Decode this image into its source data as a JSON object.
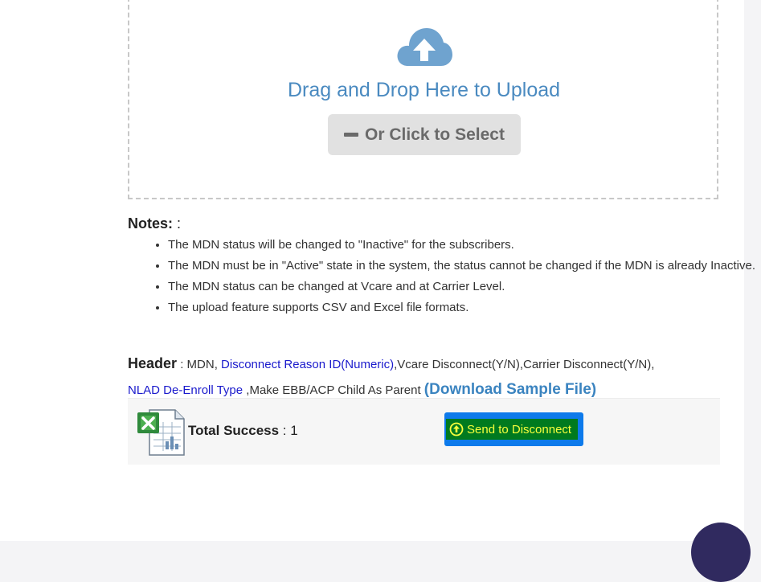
{
  "upload": {
    "title": "Drag and Drop Here to Upload",
    "select_label": "Or Click to Select"
  },
  "notes": {
    "label": "Notes:",
    "suffix": " :",
    "items": [
      "The MDN status will be changed to \"Inactive\" for the subscribers.",
      "The MDN must be in \"Active\" state in the system, the status cannot be changed if the MDN is already Inactive.",
      "The MDN status can be changed at Vcare and at Carrier Level.",
      "The upload feature supports CSV and Excel file formats."
    ]
  },
  "header": {
    "label": "Header",
    "colon": " : ",
    "part1": "MDN, ",
    "link1": "Disconnect Reason ID(Numeric)",
    "part2": ",Vcare Disconnect(Y/N),Carrier Disconnect(Y/N),",
    "link2": "NLAD De-Enroll Type",
    "part3": " ,Make EBB/ACP Child As Parent ",
    "download": "(Download Sample File)"
  },
  "result": {
    "total_label": "Total Success",
    "total_sep": " : ",
    "total_value": "1",
    "send_label": "Send to Disconnect"
  },
  "colors": {
    "accent_blue": "#4a8ac0",
    "send_button_bg": "#0d7aeb",
    "send_inner_bg": "#007a1f",
    "send_text": "#f6ff3c",
    "fab": "#302a5f"
  },
  "icons": {
    "cloud": "cloud-upload-icon",
    "minus": "minus-icon",
    "excel": "excel-file-icon",
    "arrow_up": "arrow-up-circle-icon"
  }
}
